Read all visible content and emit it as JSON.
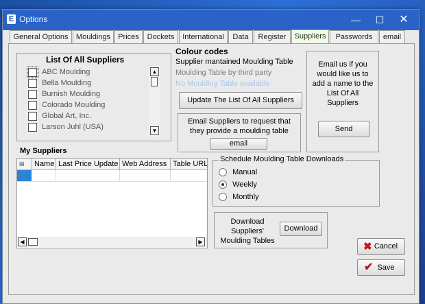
{
  "window": {
    "title": "Options",
    "app_icon": "E"
  },
  "tabs": [
    {
      "label": "General Options"
    },
    {
      "label": "Mouldings"
    },
    {
      "label": "Prices"
    },
    {
      "label": "Dockets"
    },
    {
      "label": "International"
    },
    {
      "label": "Data"
    },
    {
      "label": "Register"
    },
    {
      "label": "Suppliers",
      "active": true
    },
    {
      "label": "Passwords"
    },
    {
      "label": "email"
    }
  ],
  "all_suppliers": {
    "title": "List Of All Suppliers",
    "items": [
      {
        "label": "ABC Moulding",
        "checked": false
      },
      {
        "label": "Bella Moulding",
        "checked": false
      },
      {
        "label": "Burnish Moulding",
        "checked": false
      },
      {
        "label": "Colorado Moulding",
        "checked": false
      },
      {
        "label": "Global Art, Inc.",
        "checked": false
      },
      {
        "label": "Larson Juhl (USA)",
        "checked": false
      }
    ]
  },
  "colour_codes": {
    "title": "Colour codes",
    "maintained": "Supplier mantained Moulding Table",
    "third_party": "Moulding Table by third party",
    "not_available": "No Moulding Table available",
    "colors": {
      "maintained": "#000000",
      "third_party": "#7a7a7a",
      "not_available": "#a9c8ea"
    }
  },
  "update_button": "Update The List Of All Suppliers",
  "email_suppliers": {
    "text": "Email Suppliers to request that they provide a moulding table",
    "button": "email"
  },
  "email_us": {
    "text": "Email us if you would like us to add a name to the List Of All Suppliers",
    "button": "Send"
  },
  "my_suppliers": {
    "title": "My Suppliers",
    "columns": [
      "Name",
      "Last Price Update",
      "Web Address",
      "Table URL"
    ]
  },
  "schedule": {
    "title": "Schedule Moulding Table Downloads",
    "options": [
      {
        "label": "Manual",
        "selected": false
      },
      {
        "label": "Weekly",
        "selected": true
      },
      {
        "label": "Monthly",
        "selected": false
      }
    ]
  },
  "download": {
    "text": "Download Suppliers' Moulding Tables",
    "button": "Download"
  },
  "actions": {
    "cancel": "Cancel",
    "save": "Save"
  }
}
